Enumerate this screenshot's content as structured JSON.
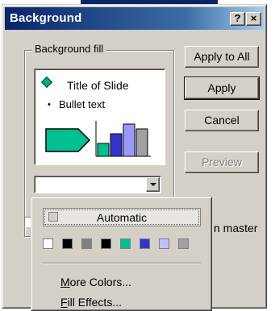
{
  "dialog": {
    "title": "Background",
    "help_button": "?",
    "close_button": "×"
  },
  "fill_group": {
    "legend": "Background fill",
    "preview": {
      "title_text": "Title of Slide",
      "bullet_text": "Bullet text",
      "shape_colors": {
        "arrow": "#00c090",
        "bar1": "#00c090",
        "bar2": "#3333cc",
        "bar3": "#9999ff",
        "bar4": "#a0a0a0"
      }
    },
    "combo_value": ""
  },
  "buttons": {
    "apply_to_all": "Apply to All",
    "apply": "Apply",
    "cancel": "Cancel",
    "preview": "Preview"
  },
  "omit_master_partial": "n master",
  "dropdown": {
    "automatic_label": "Automatic",
    "swatches": [
      "#ffffff",
      "#000000",
      "#808080",
      "#000000",
      "#00c090",
      "#3333cc",
      "#c0c0ff",
      "#a0a0a0"
    ],
    "more_colors": {
      "accel": "M",
      "rest": "ore Colors..."
    },
    "fill_effects": {
      "accel": "F",
      "rest": "ill Effects..."
    }
  }
}
